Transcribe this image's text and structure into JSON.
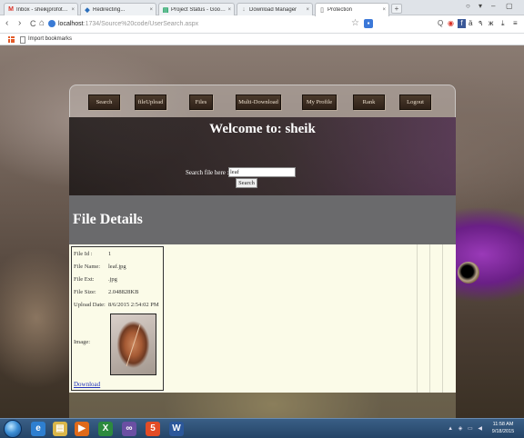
{
  "browser": {
    "tabs": [
      {
        "icon": "M",
        "icon_color": "#d93025",
        "title": "Inbox - sheikjprofotech@g"
      },
      {
        "icon": "◆",
        "icon_color": "#2a6ebb",
        "title": "Redirecting..."
      },
      {
        "icon": "▤",
        "icon_color": "#0f9d58",
        "title": "Project Status - Google Sh"
      },
      {
        "icon": "↓",
        "icon_color": "#888888",
        "title": "Download Manager"
      },
      {
        "icon": "▯",
        "icon_color": "#999999",
        "title": "Protection"
      }
    ],
    "tab_close": "×",
    "new_tab": "+",
    "window_controls": {
      "user": "○",
      "menu": "▾",
      "minimize": "–",
      "maximize": "▢"
    },
    "nav": {
      "back": "‹",
      "forward": "›",
      "reload": "C",
      "home": "⌂"
    },
    "address": {
      "host": "localhost",
      "path": ":1734/Source%20code/UserSearch.aspx"
    },
    "bookmark_star": "☆",
    "extensions": [
      "Q",
      "◉",
      "f",
      "ä",
      "٩",
      "ж",
      "⤓",
      "≡"
    ],
    "bookmarks_bar": {
      "item": "Import bookmarks"
    }
  },
  "nav_menu": [
    "Search",
    "fileUpload",
    "Files",
    "Multi-Download",
    "My Profile",
    "Rank",
    "Logout"
  ],
  "welcome": "Welcome to: sheik",
  "search": {
    "label": "Search file here :",
    "value": "leaf",
    "button": "Search"
  },
  "details_title": "File Details",
  "file": {
    "labels": {
      "id": "File Id :",
      "name": "File Name:",
      "ext": "File Ext:",
      "size": "File Size:",
      "date": "Upload Date:",
      "image": "Image:"
    },
    "values": {
      "id": "1",
      "name": "leaf.jpg",
      "ext": ".jpg",
      "size": "2.048828KB",
      "date": "8/6/2015 2:54:02 PM"
    },
    "download": "Download"
  },
  "taskbar": {
    "apps": [
      "e",
      "▤",
      "▶",
      "X",
      "∞",
      "5",
      "W"
    ],
    "tray": "▲ ◈ ▭ ◀",
    "time": "11:58 AM",
    "date": "9/18/2015"
  }
}
